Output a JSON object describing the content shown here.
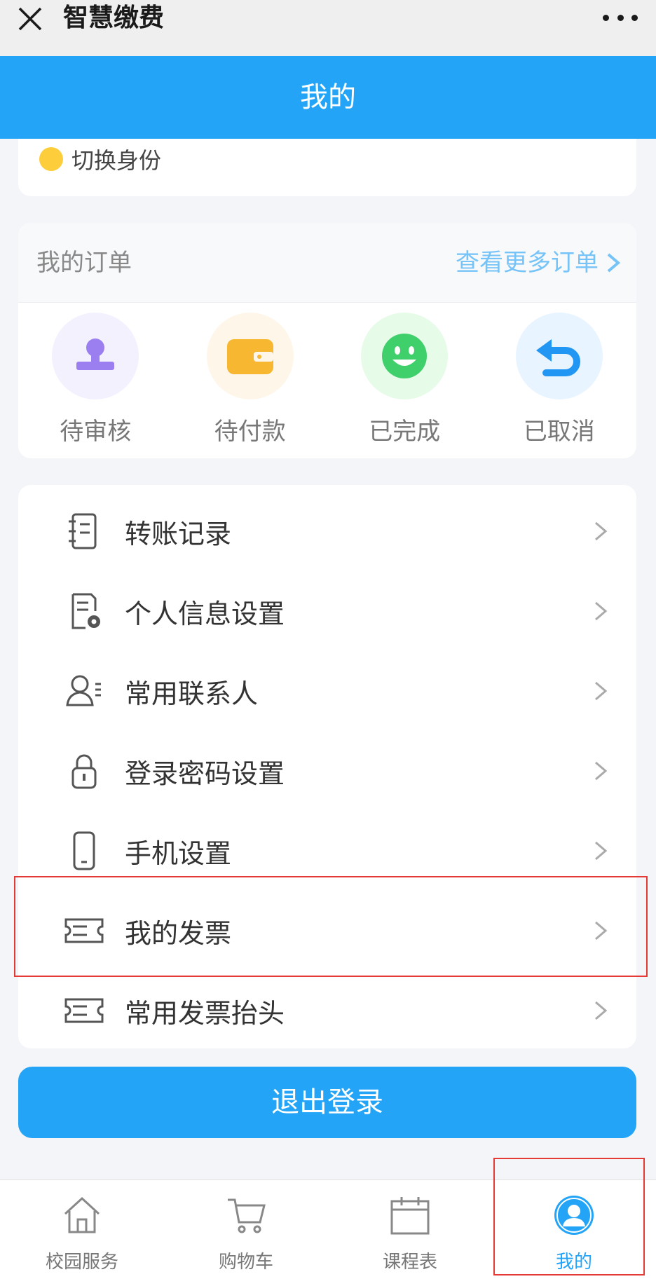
{
  "wechat": {
    "title": "智慧缴费"
  },
  "header": {
    "title": "我的"
  },
  "profile": {
    "switch_label": "切换身份"
  },
  "orders": {
    "title": "我的订单",
    "more_label": "查看更多订单",
    "items": [
      {
        "label": "待审核",
        "icon": "stamp-icon",
        "bg": "#f4f1fe",
        "color": "#9b7ef0"
      },
      {
        "label": "待付款",
        "icon": "wallet-icon",
        "bg": "#fff6ea",
        "color": "#f7b731"
      },
      {
        "label": "已完成",
        "icon": "smile-icon",
        "bg": "#e7fbe9",
        "color": "#3fcf6b"
      },
      {
        "label": "已取消",
        "icon": "undo-icon",
        "bg": "#e8f4ff",
        "color": "#2196f3"
      }
    ]
  },
  "menu": {
    "items": [
      {
        "label": "转账记录",
        "icon": "notebook-icon"
      },
      {
        "label": "个人信息设置",
        "icon": "doc-settings-icon"
      },
      {
        "label": "常用联系人",
        "icon": "contact-icon"
      },
      {
        "label": "登录密码设置",
        "icon": "lock-icon"
      },
      {
        "label": "手机设置",
        "icon": "phone-icon"
      },
      {
        "label": "我的发票",
        "icon": "ticket-icon"
      },
      {
        "label": "常用发票抬头",
        "icon": "ticket-icon"
      }
    ]
  },
  "logout_label": "退出登录",
  "tabbar": {
    "items": [
      {
        "label": "校园服务",
        "icon": "home-icon"
      },
      {
        "label": "购物车",
        "icon": "cart-icon"
      },
      {
        "label": "课程表",
        "icon": "calendar-icon"
      },
      {
        "label": "我的",
        "icon": "user-avatar-icon",
        "active": true
      }
    ]
  },
  "colors": {
    "primary": "#23a4f7",
    "highlight": "#e53935"
  }
}
